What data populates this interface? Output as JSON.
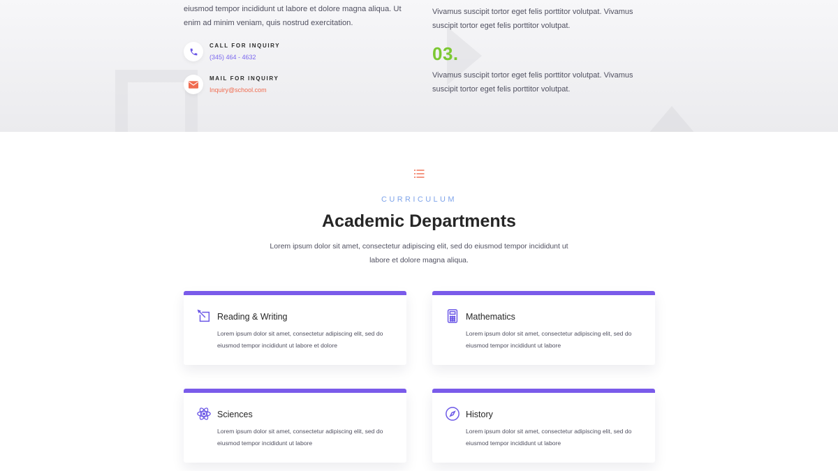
{
  "top": {
    "intro": "eiusmod tempor incididunt ut labore et dolore magna aliqua. Ut enim ad minim veniam, quis nostrud exercitation.",
    "phone": {
      "label": "Call for inquiry",
      "value": "(345) 464 - 4632",
      "icon": "phone-icon"
    },
    "mail": {
      "label": "Mail for inquiry",
      "value": "Inquiry@school.com",
      "icon": "mail-icon"
    },
    "step2_text": "Vivamus suscipit tortor eget felis porttitor volutpat. Vivamus suscipit tortor eget felis porttitor volutpat.",
    "step3_number": "03.",
    "step3_text": "Vivamus suscipit tortor eget felis porttitor volutpat. Vivamus suscipit tortor eget felis porttitor volutpat."
  },
  "curriculum": {
    "icon": "list-icon",
    "eyebrow": "Curriculum",
    "title": "Academic Departments",
    "description": "Lorem ipsum dolor sit amet, consectetur adipiscing elit, sed do eiusmod tempor incididunt ut labore et dolore magna aliqua.",
    "departments": [
      {
        "title": "Reading & Writing",
        "icon": "pen-icon",
        "text": "Lorem ipsum dolor sit amet, consectetur adipiscing elit, sed do eiusmod tempor incididunt ut labore et dolore"
      },
      {
        "title": "Mathematics",
        "icon": "calculator-icon",
        "text": "Lorem ipsum dolor sit amet, consectetur adipiscing elit, sed do eiusmod tempor incididunt ut labore"
      },
      {
        "title": "Sciences",
        "icon": "atom-icon",
        "text": "Lorem ipsum dolor sit amet, consectetur adipiscing elit, sed do eiusmod tempor incididunt ut labore"
      },
      {
        "title": "History",
        "icon": "compass-icon",
        "text": "Lorem ipsum dolor sit amet, consectetur adipiscing elit, sed do eiusmod tempor incididunt ut labore"
      }
    ]
  },
  "colors": {
    "accent_purple": "#7a5bea",
    "step_green": "#7cc832",
    "eyebrow_blue": "#7fa4ea",
    "mail_orange": "#f06b4f"
  }
}
